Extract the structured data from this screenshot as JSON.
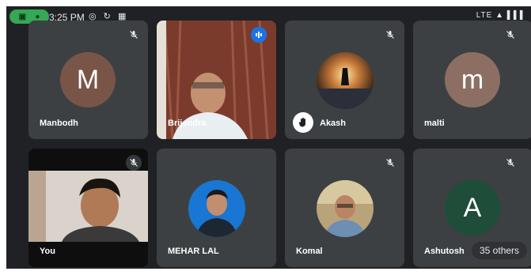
{
  "status_bar": {
    "time": "3:25 PM",
    "left_icons": [
      "whatsapp-icon",
      "sync-icon",
      "gallery-icon"
    ],
    "right_icons": "LTE ▲ ▌▌▌"
  },
  "participants": [
    {
      "name": "Manbodh",
      "initial": "M",
      "avatar_color": "#795548",
      "muted": true
    },
    {
      "name": "Brijendra",
      "video": true,
      "speaking": true
    },
    {
      "name": "Akash",
      "photo": true,
      "muted": true,
      "hand_raised": true
    },
    {
      "name": "malti",
      "initial": "m",
      "avatar_color": "#8d6e63",
      "muted": true
    },
    {
      "name": "You",
      "video": true,
      "muted": true
    },
    {
      "name": "MEHAR LAL",
      "photo": true,
      "muted": false
    },
    {
      "name": "Komal",
      "photo": true,
      "muted": true
    },
    {
      "name": "Ashutosh",
      "initial": "A",
      "avatar_color": "#1e4d3a",
      "muted": true
    }
  ],
  "others_label": "35 others"
}
